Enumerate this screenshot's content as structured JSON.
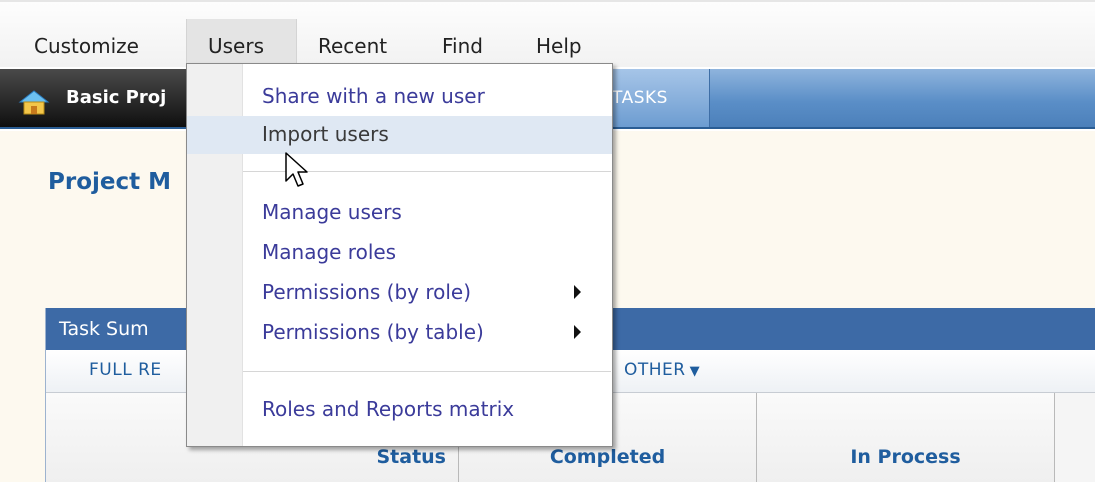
{
  "menubar": {
    "items": [
      "Customize",
      "Users",
      "Recent",
      "Find",
      "Help"
    ],
    "active": "Users"
  },
  "tabs": {
    "app_tab": "Basic Proj",
    "tasks_tab": "TASKS"
  },
  "page": {
    "title": "Project M"
  },
  "panel": {
    "title": "Task Sum",
    "toolbar": {
      "full_report": "FULL RE",
      "other": "OTHER",
      "other_icon": "caret-down-icon"
    },
    "columns": [
      "Status",
      "Completed",
      "In Process"
    ]
  },
  "dropdown": {
    "items": [
      {
        "label": "Share with a new user",
        "submenu": false
      },
      {
        "label": "Import users",
        "submenu": false,
        "hovered": true
      },
      {
        "label": "Manage users",
        "submenu": false
      },
      {
        "label": "Manage roles",
        "submenu": false
      },
      {
        "label": "Permissions (by role)",
        "submenu": true
      },
      {
        "label": "Permissions (by table)",
        "submenu": true
      },
      {
        "label": "Roles and Reports matrix",
        "submenu": false
      }
    ]
  },
  "colors": {
    "link": "#1f5d9e",
    "menu_link": "#3b3b9a",
    "tabbar": "#5a8ec7",
    "panel_header": "#3d6aa6",
    "content_bg": "#fdf9ef"
  }
}
